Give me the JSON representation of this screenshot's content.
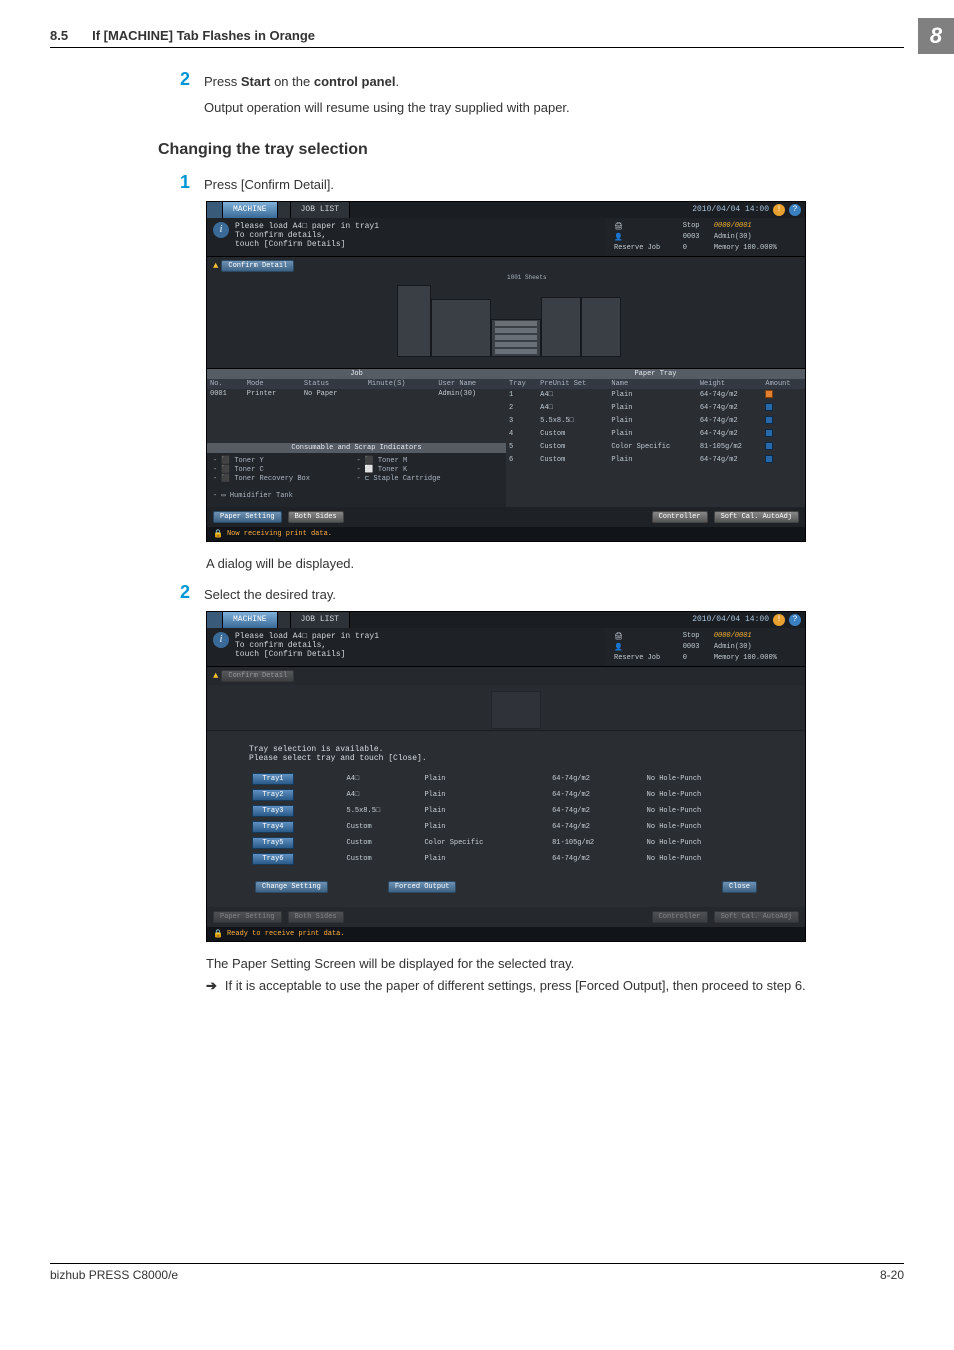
{
  "header": {
    "section_num": "8.5",
    "section_title": "If [MACHINE] Tab Flashes in Orange",
    "chapter_badge": "8"
  },
  "intro": {
    "step2_num": "2",
    "step2_line1_a": "Press ",
    "step2_line1_b": "Start",
    "step2_line1_c": " on the ",
    "step2_line1_d": "control panel",
    "step2_line1_e": ".",
    "step2_sub": "Output operation will resume using the tray supplied with paper."
  },
  "section2": {
    "title": "Changing the tray selection",
    "step1_num": "1",
    "step1_text": "Press [Confirm Detail].",
    "after1": "A dialog will be displayed.",
    "step2_num": "2",
    "step2_text": "Select the desired tray.",
    "after2": "The Paper Setting Screen will be displayed for the selected tray.",
    "arrow": "➔",
    "arrow_text": "If it is acceptable to use the paper of different settings, press [Forced Output], then proceed to step 6."
  },
  "panel": {
    "top": {
      "machine": "MACHINE",
      "joblist": "JOB LIST",
      "datetime": "2010/04/04 14:00",
      "help": "?"
    },
    "msg": {
      "l1": "Please load    A4□    paper in tray1",
      "l2": "To confirm details,",
      "l3": "touch [Confirm Details]"
    },
    "right": {
      "stop": "Stop",
      "jobno": "0000/0001",
      "user_lbl": "0003",
      "user": "Admin(30)",
      "reserve_lbl": "Reserve Job",
      "reserve_val": "0",
      "memory_lbl": "Memory",
      "memory_val": "100.000%"
    },
    "confirm_btn": "Confirm Detail",
    "remain_lbl": "1001\nSheets",
    "job_section": "Job",
    "job_headers": [
      "No.",
      "Mode",
      "Status",
      "Minute(S)",
      "User Name"
    ],
    "job_row": [
      "0001",
      "Printer",
      "No Paper",
      "",
      "Admin(30)"
    ],
    "tray_section": "Paper Tray",
    "tray_headers": [
      "Tray",
      "PreUnit Set",
      "Name",
      "Weight",
      "Amount"
    ],
    "tray_rows": [
      [
        "1",
        "A4□",
        "Plain",
        "64-74g/m2"
      ],
      [
        "2",
        "A4□",
        "Plain",
        "64-74g/m2"
      ],
      [
        "3",
        "5.5x8.5□",
        "Plain",
        "64-74g/m2"
      ],
      [
        "4",
        "Custom",
        "Plain",
        "64-74g/m2"
      ],
      [
        "5",
        "Custom",
        "Color Specific",
        "81-105g/m2"
      ],
      [
        "6",
        "Custom",
        "Plain",
        "64-74g/m2"
      ]
    ],
    "consumables_section": "Consumable and Scrap Indicators",
    "consumables": {
      "left": [
        "Toner Y",
        "Toner C",
        "Toner Recovery Box"
      ],
      "right": [
        "Toner M",
        "Toner K",
        "Staple Cartridge"
      ],
      "humid": "Humidifier Tank"
    },
    "bottom_buttons": {
      "paper_setting": "Paper Setting",
      "both_sides": "Both Sides",
      "controller": "Controller",
      "soft_cal": "Soft Cal. AutoAdj"
    },
    "statusbar1": "Now receiving print data.",
    "change_setting": "Change Setting",
    "forced_output": "Forced Output",
    "close": "Close",
    "statusbar2": "Ready to receive print data."
  },
  "dialog": {
    "msg1": "Tray selection is available.",
    "msg2": "Please select tray and touch [Close].",
    "rows": [
      [
        "Tray1",
        "A4□",
        "Plain",
        "64-74g/m2",
        "No Hole-Punch"
      ],
      [
        "Tray2",
        "A4□",
        "Plain",
        "64-74g/m2",
        "No Hole-Punch"
      ],
      [
        "Tray3",
        "5.5x8.5□",
        "Plain",
        "64-74g/m2",
        "No Hole-Punch"
      ],
      [
        "Tray4",
        "Custom",
        "Plain",
        "64-74g/m2",
        "No Hole-Punch"
      ],
      [
        "Tray5",
        "Custom",
        "Color Specific",
        "81-105g/m2",
        "No Hole-Punch"
      ],
      [
        "Tray6",
        "Custom",
        "Plain",
        "64-74g/m2",
        "No Hole-Punch"
      ]
    ]
  },
  "footer": {
    "product": "bizhub PRESS C8000/e",
    "page": "8-20"
  }
}
